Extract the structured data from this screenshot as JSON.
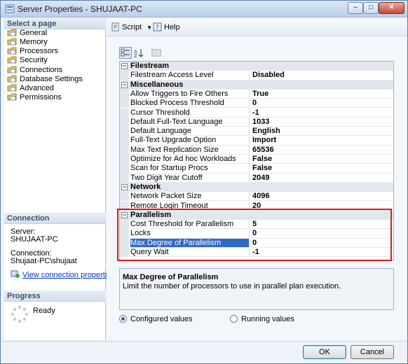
{
  "window": {
    "title": "Server Properties - SHUJAAT-PC",
    "min": "–",
    "max": "□",
    "close": "✕"
  },
  "left": {
    "select_page_header": "Select a page",
    "pages": [
      "General",
      "Memory",
      "Processors",
      "Security",
      "Connections",
      "Database Settings",
      "Advanced",
      "Permissions"
    ],
    "connection_header": "Connection",
    "server_label": "Server:",
    "server_value": "SHUJAAT-PC",
    "connection_label": "Connection:",
    "connection_value": "Shujaat-PC\\shujaat",
    "view_link": "View connection properties",
    "progress_header": "Progress",
    "progress_status": "Ready"
  },
  "toolbar": {
    "script_label": "Script",
    "help_label": "Help"
  },
  "grid": {
    "rows": [
      {
        "type": "cat",
        "label": "Filestream"
      },
      {
        "type": "prop",
        "name": "Filestream Access Level",
        "value": "Disabled"
      },
      {
        "type": "cat",
        "label": "Miscellaneous"
      },
      {
        "type": "prop",
        "name": "Allow Triggers to Fire Others",
        "value": "True"
      },
      {
        "type": "prop",
        "name": "Blocked Process Threshold",
        "value": "0"
      },
      {
        "type": "prop",
        "name": "Cursor Threshold",
        "value": "-1"
      },
      {
        "type": "prop",
        "name": "Default Full-Text Language",
        "value": "1033"
      },
      {
        "type": "prop",
        "name": "Default Language",
        "value": "English"
      },
      {
        "type": "prop",
        "name": "Full-Text Upgrade Option",
        "value": "Import"
      },
      {
        "type": "prop",
        "name": "Max Text Replication Size",
        "value": "65536"
      },
      {
        "type": "prop",
        "name": "Optimize for Ad hoc Workloads",
        "value": "False"
      },
      {
        "type": "prop",
        "name": "Scan for Startup Procs",
        "value": "False"
      },
      {
        "type": "prop",
        "name": "Two Digit Year Cutoff",
        "value": "2049"
      },
      {
        "type": "cat",
        "label": "Network"
      },
      {
        "type": "prop",
        "name": "Network Packet Size",
        "value": "4096"
      },
      {
        "type": "prop",
        "name": "Remote Login Timeout",
        "value": "20"
      },
      {
        "type": "cat",
        "label": "Parallelism"
      },
      {
        "type": "prop",
        "name": "Cost Threshold for Parallelism",
        "value": "5"
      },
      {
        "type": "prop",
        "name": "Locks",
        "value": "0"
      },
      {
        "type": "prop",
        "name": "Max Degree of Parallelism",
        "value": "0",
        "selected": true
      },
      {
        "type": "prop",
        "name": "Query Wait",
        "value": "-1"
      }
    ]
  },
  "description": {
    "title": "Max Degree of Parallelism",
    "text": "Limit the number of processors to use in parallel plan execution."
  },
  "options": {
    "configured": "Configured values",
    "running": "Running values"
  },
  "buttons": {
    "ok": "OK",
    "cancel": "Cancel"
  },
  "colors": {
    "selection": "#3169c6",
    "highlight_border": "#d11f1f",
    "category_bg": "#e2e7ee"
  }
}
